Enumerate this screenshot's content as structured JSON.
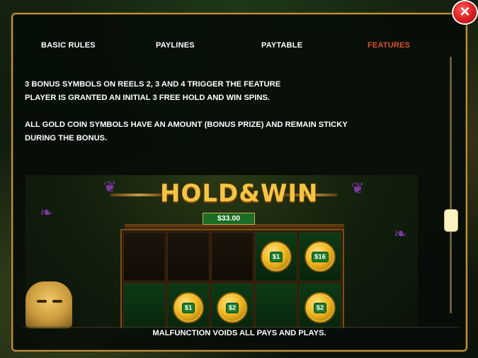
{
  "tabs": [
    {
      "label": "BASIC RULES",
      "active": false
    },
    {
      "label": "PAYLINES",
      "active": false
    },
    {
      "label": "PAYTABLE",
      "active": false
    },
    {
      "label": "FEATURES",
      "active": true
    }
  ],
  "content": {
    "para1_line1": "3 BONUS SYMBOLS ON REELS 2, 3 AND 4 TRIGGER THE FEATURE",
    "para1_line2": "PLAYER IS GRANTED AN INITIAL 3 FREE HOLD AND WIN SPINS.",
    "para2_line1": "ALL GOLD COIN SYMBOLS HAVE AN AMOUNT (BONUS PRIZE) AND REMAIN STICKY",
    "para2_line2": "DURING THE BONUS."
  },
  "feature_image": {
    "title": "HOLD&WIN",
    "prize_display": "$33.00",
    "grid": [
      [
        null,
        null,
        null,
        "$1",
        "$16"
      ],
      [
        null,
        "$1",
        "$2",
        null,
        "$2"
      ]
    ]
  },
  "footer": {
    "text": "MALFUNCTION VOIDS ALL PAYS AND PLAYS."
  },
  "close_icon": "×",
  "colors": {
    "active_tab": "#d9522e",
    "border_gold": "#b8913c",
    "close_red": "#d81e1e"
  }
}
